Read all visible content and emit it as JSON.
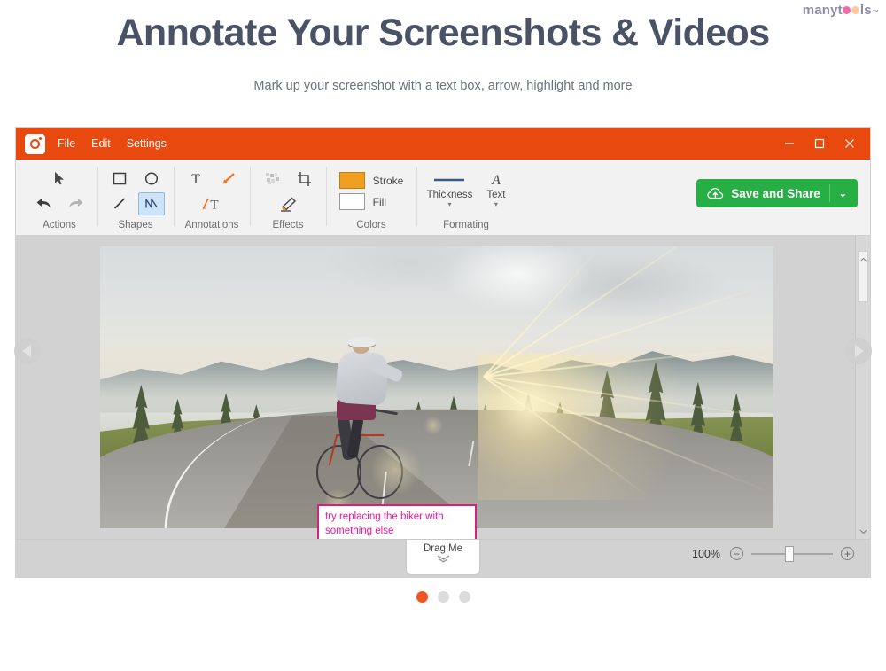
{
  "brand": {
    "prefix": "manyt",
    "suffix": "ls",
    "tm": "™"
  },
  "header": {
    "title": "Annotate Your Screenshots & Videos",
    "subtitle": "Mark up your screenshot with a text box, arrow, highlight and more"
  },
  "app": {
    "menu": [
      "File",
      "Edit",
      "Settings"
    ],
    "window_controls": {
      "minimize": "minimize-icon",
      "maximize": "maximize-icon",
      "close": "close-icon"
    },
    "ribbon": {
      "groups": [
        {
          "label": "Actions",
          "tools": [
            "cursor-icon",
            "undo-icon",
            "redo-icon"
          ]
        },
        {
          "label": "Shapes",
          "tools": [
            "rectangle-icon",
            "ellipse-icon",
            "line-icon",
            "freehand-icon"
          ],
          "selected": "freehand-icon"
        },
        {
          "label": "Annotations",
          "tools": [
            "text-icon",
            "arrow-icon",
            "text-callout-icon"
          ]
        },
        {
          "label": "Effects",
          "tools": [
            "pixelate-icon",
            "crop-icon",
            "highlighter-icon"
          ]
        }
      ],
      "colors": {
        "label": "Colors",
        "stroke_label": "Stroke",
        "fill_label": "Fill",
        "stroke_color": "#f0a01e",
        "fill_color": "#ffffff"
      },
      "formating": {
        "label": "Formating",
        "thickness_label": "Thickness",
        "text_label": "Text",
        "caret": "▾"
      },
      "save_share": {
        "label": "Save and Share",
        "icon": "cloud-upload-icon",
        "caret": "⌄",
        "color": "#27ae45"
      }
    },
    "canvas": {
      "annotation_text": "try replacing the biker with\nsomething else",
      "annotation_border_color": "#d6207e",
      "annotation_text_color": "#e8189a",
      "highlight_color": "#2ec4d6"
    },
    "status": {
      "drag_label": "Drag Me",
      "drag_chevron": "⌄⌄",
      "zoom_level": "100%",
      "zoom_out": "−",
      "zoom_in": "+"
    }
  },
  "carousel": {
    "prev": "prev-slide-arrow",
    "next": "next-slide-arrow",
    "dots": [
      {
        "active": true
      },
      {
        "active": false
      },
      {
        "active": false
      }
    ],
    "active_color": "#ef5423"
  }
}
